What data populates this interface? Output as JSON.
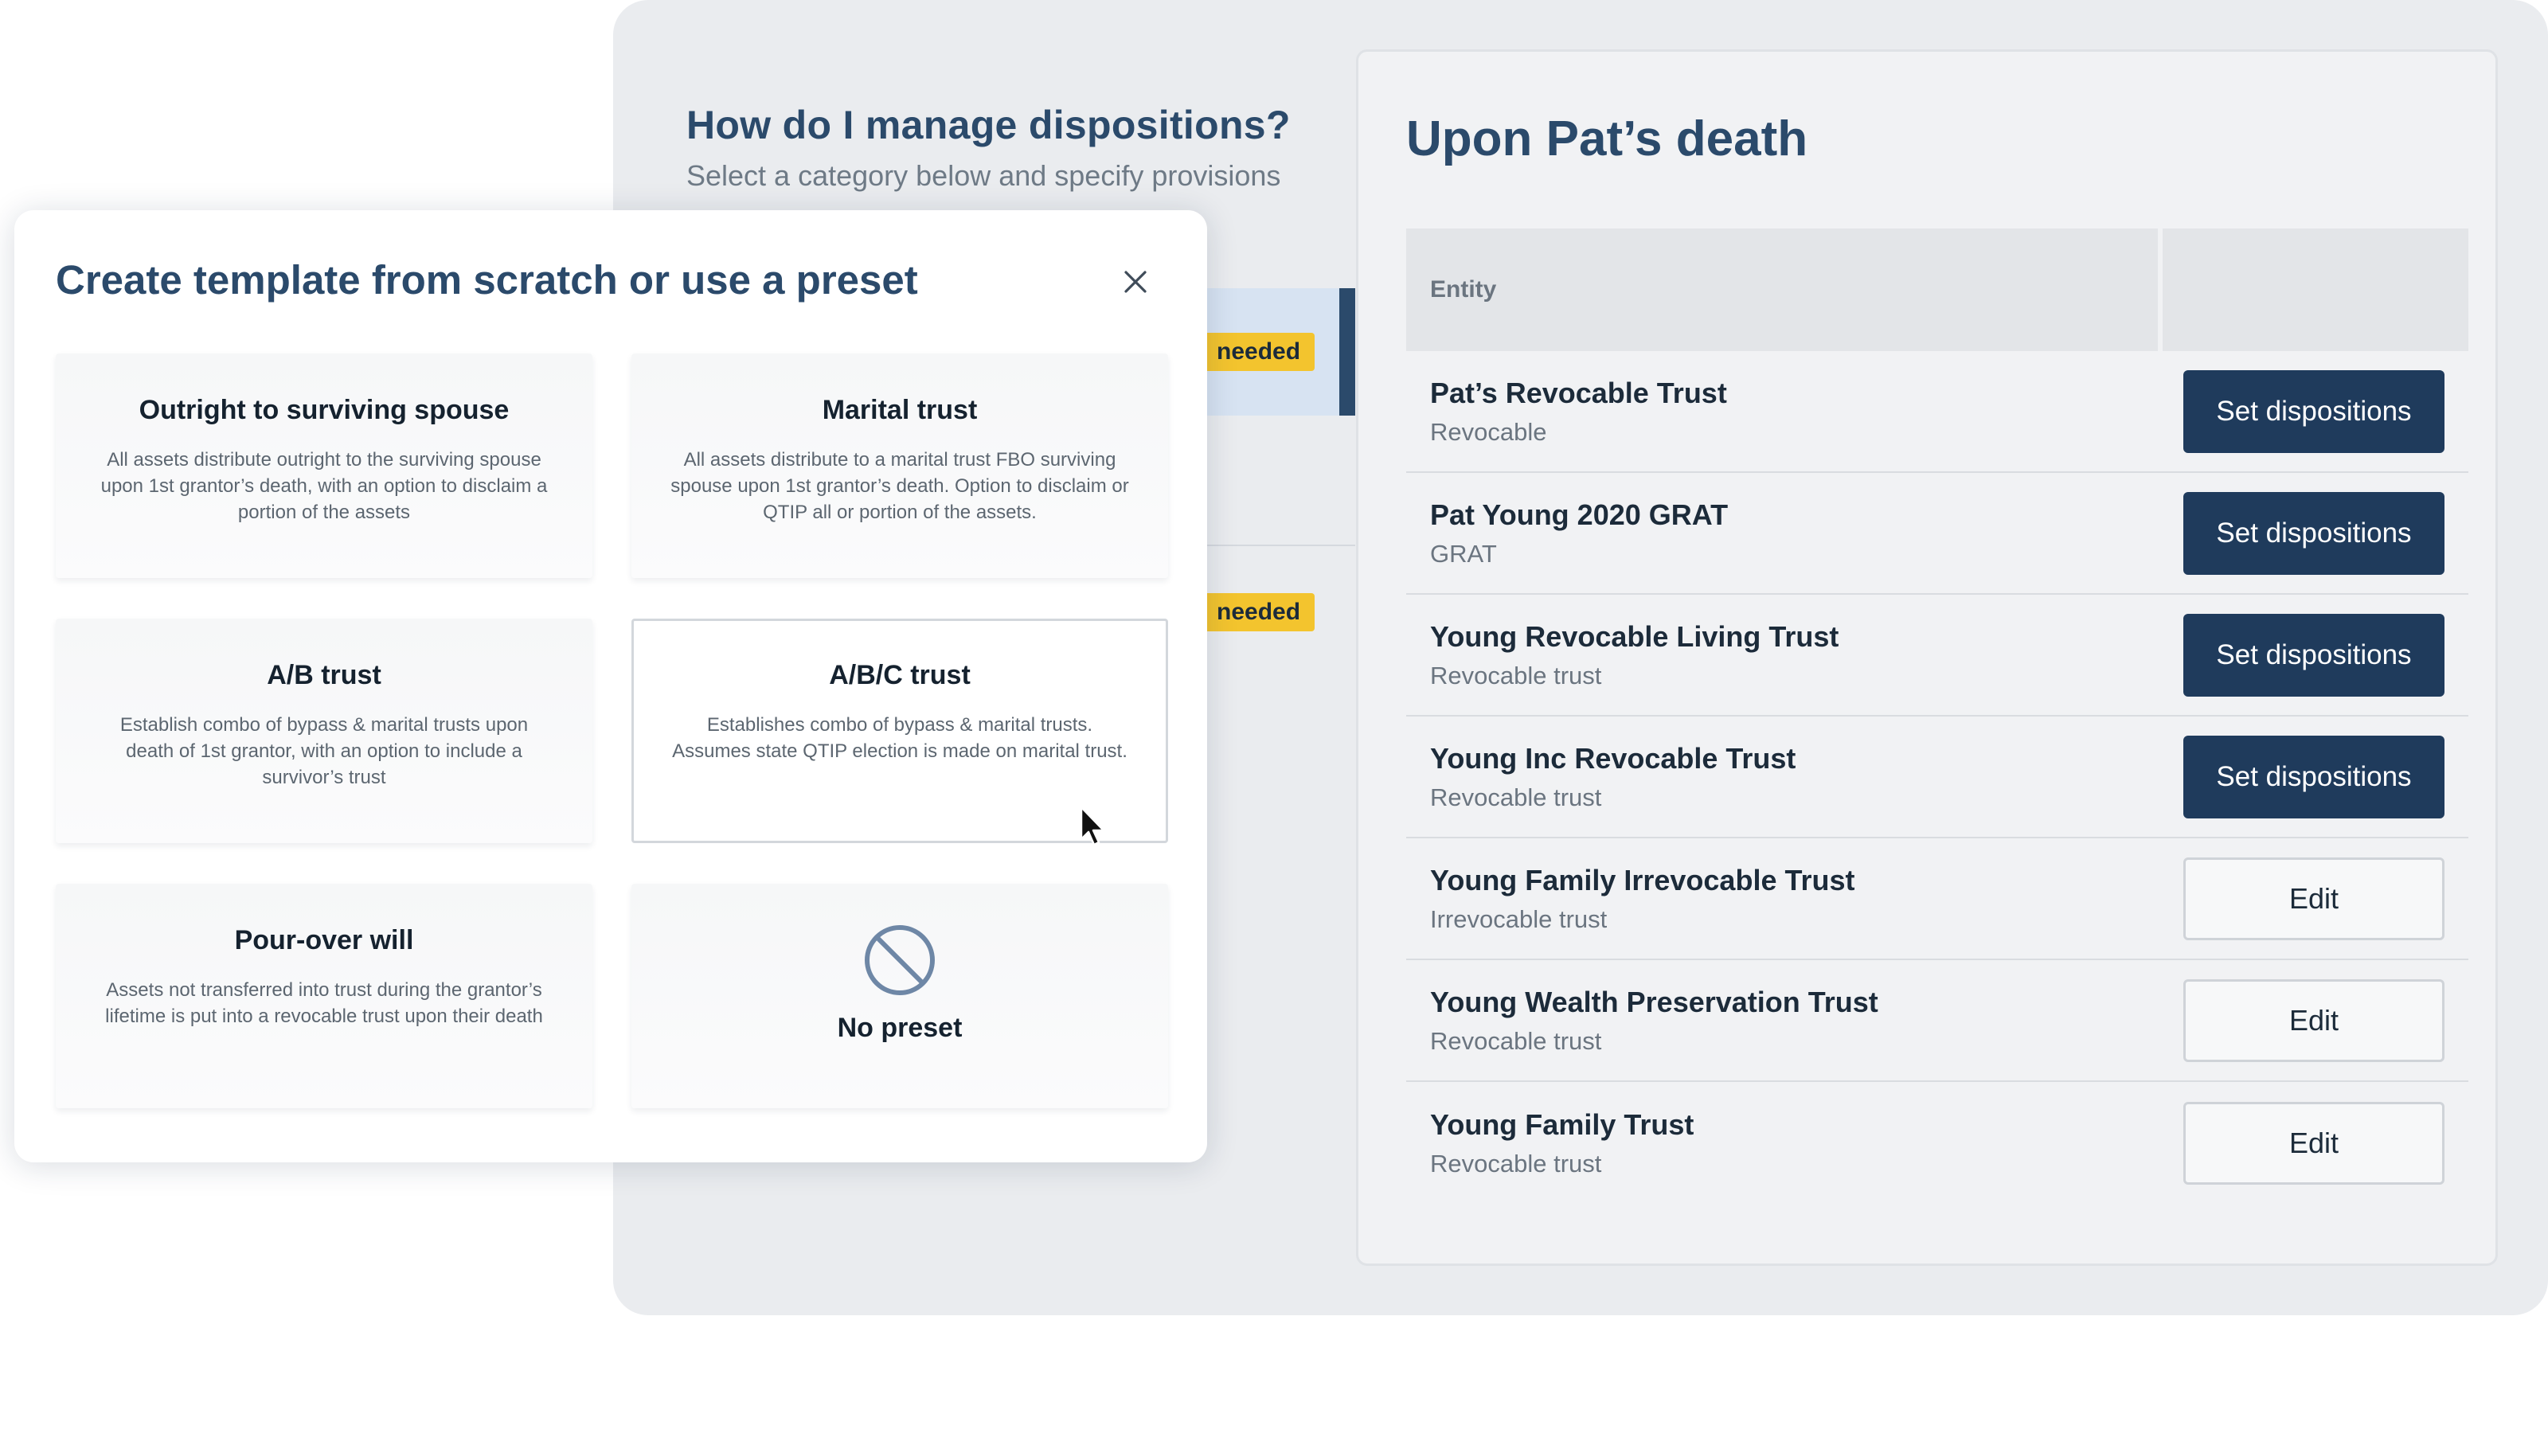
{
  "background_panel": {
    "help_title": "How do I manage dispositions?",
    "help_subtitle": "Select a category below and specify provisions",
    "badges": [
      "needed",
      "needed"
    ]
  },
  "death_panel": {
    "title": "Upon Pat’s death",
    "column_entity": "Entity",
    "rows": [
      {
        "name": "Pat’s Revocable Trust",
        "type": "Revocable",
        "action": "Set dispositions",
        "action_kind": "primary"
      },
      {
        "name": "Pat Young 2020 GRAT",
        "type": "GRAT",
        "action": "Set dispositions",
        "action_kind": "primary"
      },
      {
        "name": "Young Revocable Living Trust",
        "type": "Revocable trust",
        "action": "Set dispositions",
        "action_kind": "primary"
      },
      {
        "name": "Young Inc Revocable Trust",
        "type": "Revocable trust",
        "action": "Set dispositions",
        "action_kind": "primary"
      },
      {
        "name": "Young Family Irrevocable Trust",
        "type": "Irrevocable trust",
        "action": "Edit",
        "action_kind": "secondary"
      },
      {
        "name": "Young Wealth Preservation Trust",
        "type": "Revocable trust",
        "action": "Edit",
        "action_kind": "secondary"
      },
      {
        "name": "Young Family Trust",
        "type": "Revocable trust",
        "action": "Edit",
        "action_kind": "secondary"
      }
    ]
  },
  "modal": {
    "title": "Create template from scratch or use a preset",
    "close_icon": "close-icon",
    "presets": [
      {
        "title": "Outright to surviving spouse",
        "description": "All assets distribute outright to the surviving spouse upon 1st grantor’s death, with an option to disclaim a portion of the assets"
      },
      {
        "title": "Marital trust",
        "description": "All assets distribute to a marital trust FBO surviving spouse upon 1st grantor’s death. Option to disclaim or QTIP all or portion of the assets."
      },
      {
        "title": "A/B trust",
        "description": "Establish combo of bypass & marital trusts upon death of 1st grantor, with an option to include a survivor’s trust"
      },
      {
        "title": "A/B/C trust",
        "description": "Establishes combo of bypass & marital trusts. Assumes state QTIP election is made on marital trust."
      },
      {
        "title": "Pour-over will",
        "description": "Assets not transferred into trust during the grantor’s lifetime is put into a revocable trust upon their death"
      }
    ],
    "no_preset": {
      "label": "No preset",
      "icon": "prohibited-icon"
    }
  },
  "colors": {
    "brand_navy": "#1f3b5c",
    "heading_blue": "#2b4a6b",
    "badge_yellow": "#f3c42e"
  }
}
